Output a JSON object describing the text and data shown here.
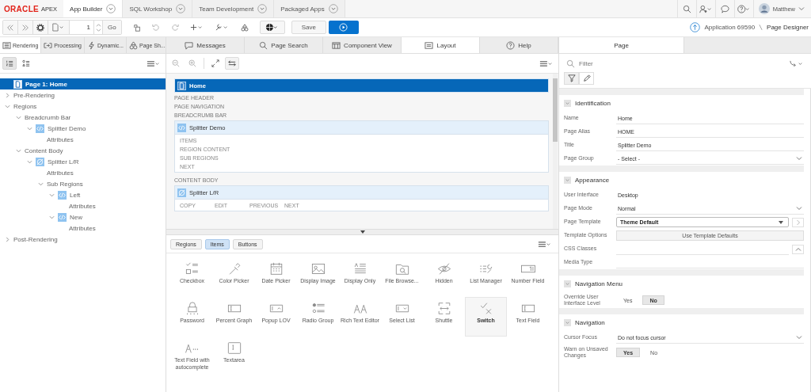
{
  "header": {
    "brand": "ORACLE",
    "product": "APEX",
    "tabs": [
      {
        "label": "App Builder",
        "selected": true
      },
      {
        "label": "SQL Workshop",
        "selected": false
      },
      {
        "label": "Team Development",
        "selected": false
      },
      {
        "label": "Packaged Apps",
        "selected": false
      }
    ],
    "user": "Matthew"
  },
  "toolbar": {
    "page_number": "1",
    "go_label": "Go",
    "save_label": "Save",
    "breadcrumb": [
      "Application 69590",
      "Page Designer"
    ]
  },
  "left_panel": {
    "tabs": [
      {
        "label": "Rendering",
        "selected": true
      },
      {
        "label": "Processing",
        "selected": false
      },
      {
        "label": "Dynamic...",
        "selected": false
      },
      {
        "label": "Page Sh...",
        "selected": false
      }
    ],
    "tree": [
      {
        "label": "Page 1: Home",
        "kind": "page",
        "selected": true
      },
      {
        "label": "Pre-Rendering",
        "kind": "group",
        "selected": false,
        "expanded": false
      },
      {
        "label": "Regions",
        "kind": "group",
        "selected": false,
        "expanded": true,
        "children": [
          {
            "label": "Breadcrumb Bar",
            "kind": "group",
            "selected": false,
            "expanded": true,
            "children": [
              {
                "label": "Splitter Demo",
                "kind": "region",
                "selected": false,
                "expanded": true,
                "children": [
                  {
                    "label": "Attributes",
                    "kind": "attributes",
                    "selected": false
                  }
                ]
              }
            ]
          },
          {
            "label": "Content Body",
            "kind": "group",
            "selected": false,
            "expanded": true,
            "children": [
              {
                "label": "Splitter L/R",
                "kind": "splitter-region",
                "selected": false,
                "expanded": true,
                "children": [
                  {
                    "label": "Attributes",
                    "kind": "attributes",
                    "selected": false
                  },
                  {
                    "label": "Sub Regions",
                    "kind": "group",
                    "selected": false,
                    "expanded": true,
                    "children": [
                      {
                        "label": "Left",
                        "kind": "region",
                        "selected": false,
                        "expanded": true,
                        "children": [
                          {
                            "label": "Attributes",
                            "kind": "attributes",
                            "selected": false
                          }
                        ]
                      },
                      {
                        "label": "New",
                        "kind": "region",
                        "selected": false,
                        "expanded": true,
                        "children": [
                          {
                            "label": "Attributes",
                            "kind": "attributes",
                            "selected": false
                          }
                        ]
                      }
                    ]
                  }
                ]
              }
            ]
          }
        ]
      },
      {
        "label": "Post-Rendering",
        "kind": "group",
        "selected": false,
        "expanded": false
      }
    ]
  },
  "center_panel": {
    "tabs": [
      {
        "label": "Messages",
        "selected": false
      },
      {
        "label": "Page Search",
        "selected": false
      },
      {
        "label": "Component View",
        "selected": false
      },
      {
        "label": "Layout",
        "selected": true
      },
      {
        "label": "Help",
        "selected": false
      }
    ],
    "layout": {
      "page_title": "Home",
      "blocks": [
        {
          "kind": "label",
          "text": "PAGE HEADER"
        },
        {
          "kind": "label",
          "text": "PAGE NAVIGATION"
        },
        {
          "kind": "label",
          "text": "BREADCRUMB BAR"
        },
        {
          "kind": "region",
          "title": "Splitter Demo",
          "slots": [
            "ITEMS",
            "REGION CONTENT",
            "SUB REGIONS",
            "NEXT"
          ]
        },
        {
          "kind": "label",
          "text": "CONTENT BODY"
        },
        {
          "kind": "splitter-region",
          "title": "Splitter L/R",
          "slots": [
            "COPY",
            "EDIT",
            "PREVIOUS",
            "NEXT"
          ]
        }
      ]
    },
    "gallery": {
      "tabs": [
        {
          "label": "Regions",
          "selected": false
        },
        {
          "label": "Items",
          "selected": true
        },
        {
          "label": "Buttons",
          "selected": false
        }
      ],
      "items": [
        {
          "label": "Checkbox",
          "selected": false
        },
        {
          "label": "Color Picker",
          "selected": false
        },
        {
          "label": "Date Picker",
          "selected": false
        },
        {
          "label": "Display Image",
          "selected": false
        },
        {
          "label": "Display Only",
          "selected": false
        },
        {
          "label": "File Browse...",
          "selected": false
        },
        {
          "label": "Hidden",
          "selected": false
        },
        {
          "label": "List Manager",
          "selected": false
        },
        {
          "label": "Number Field",
          "selected": false
        },
        {
          "label": "Password",
          "selected": false
        },
        {
          "label": "Percent Graph",
          "selected": false
        },
        {
          "label": "Popup LOV",
          "selected": false
        },
        {
          "label": "Radio Group",
          "selected": false
        },
        {
          "label": "Rich Text Editor",
          "selected": false
        },
        {
          "label": "Select List",
          "selected": false
        },
        {
          "label": "Shuttle",
          "selected": false
        },
        {
          "label": "Switch",
          "selected": true
        },
        {
          "label": "Text Field",
          "selected": false
        },
        {
          "label": "Text Field with autocomplete",
          "selected": false
        },
        {
          "label": "Textarea",
          "selected": false
        }
      ]
    }
  },
  "right_panel": {
    "tabs": [
      {
        "label": "Page",
        "selected": true
      }
    ],
    "filter_placeholder": "Filter",
    "sections": [
      {
        "title": "Identification",
        "expanded": true,
        "properties": [
          {
            "label": "Name",
            "kind": "text",
            "value": "Home"
          },
          {
            "label": "Page Alias",
            "kind": "text",
            "value": "HOME"
          },
          {
            "label": "Title",
            "kind": "text",
            "value": "Splitter Demo"
          },
          {
            "label": "Page Group",
            "kind": "select",
            "value": "- Select -"
          }
        ]
      },
      {
        "title": "Appearance",
        "expanded": true,
        "properties": [
          {
            "label": "User Interface",
            "kind": "static",
            "value": "Desktop"
          },
          {
            "label": "Page Mode",
            "kind": "select",
            "value": "Normal"
          },
          {
            "label": "Page Template",
            "kind": "template-select",
            "value": "Theme Default"
          },
          {
            "label": "Template Options",
            "kind": "button",
            "value": "Use Template Defaults"
          },
          {
            "label": "CSS Classes",
            "kind": "text-expand"
          },
          {
            "label": "Media Type",
            "kind": "text"
          }
        ]
      },
      {
        "title": "Navigation Menu",
        "expanded": true,
        "properties": [
          {
            "label": "Override User Interface Level",
            "kind": "toggle",
            "options": [
              {
                "label": "Yes",
                "selected": false
              },
              {
                "label": "No",
                "selected": true
              }
            ]
          }
        ]
      },
      {
        "title": "Navigation",
        "expanded": true,
        "properties": [
          {
            "label": "Cursor Focus",
            "kind": "select",
            "value": "Do not focus cursor"
          },
          {
            "label": "Warn on Unsaved Changes",
            "kind": "toggle",
            "options": [
              {
                "label": "Yes",
                "selected": true
              },
              {
                "label": "No",
                "selected": false
              }
            ]
          }
        ]
      }
    ]
  }
}
